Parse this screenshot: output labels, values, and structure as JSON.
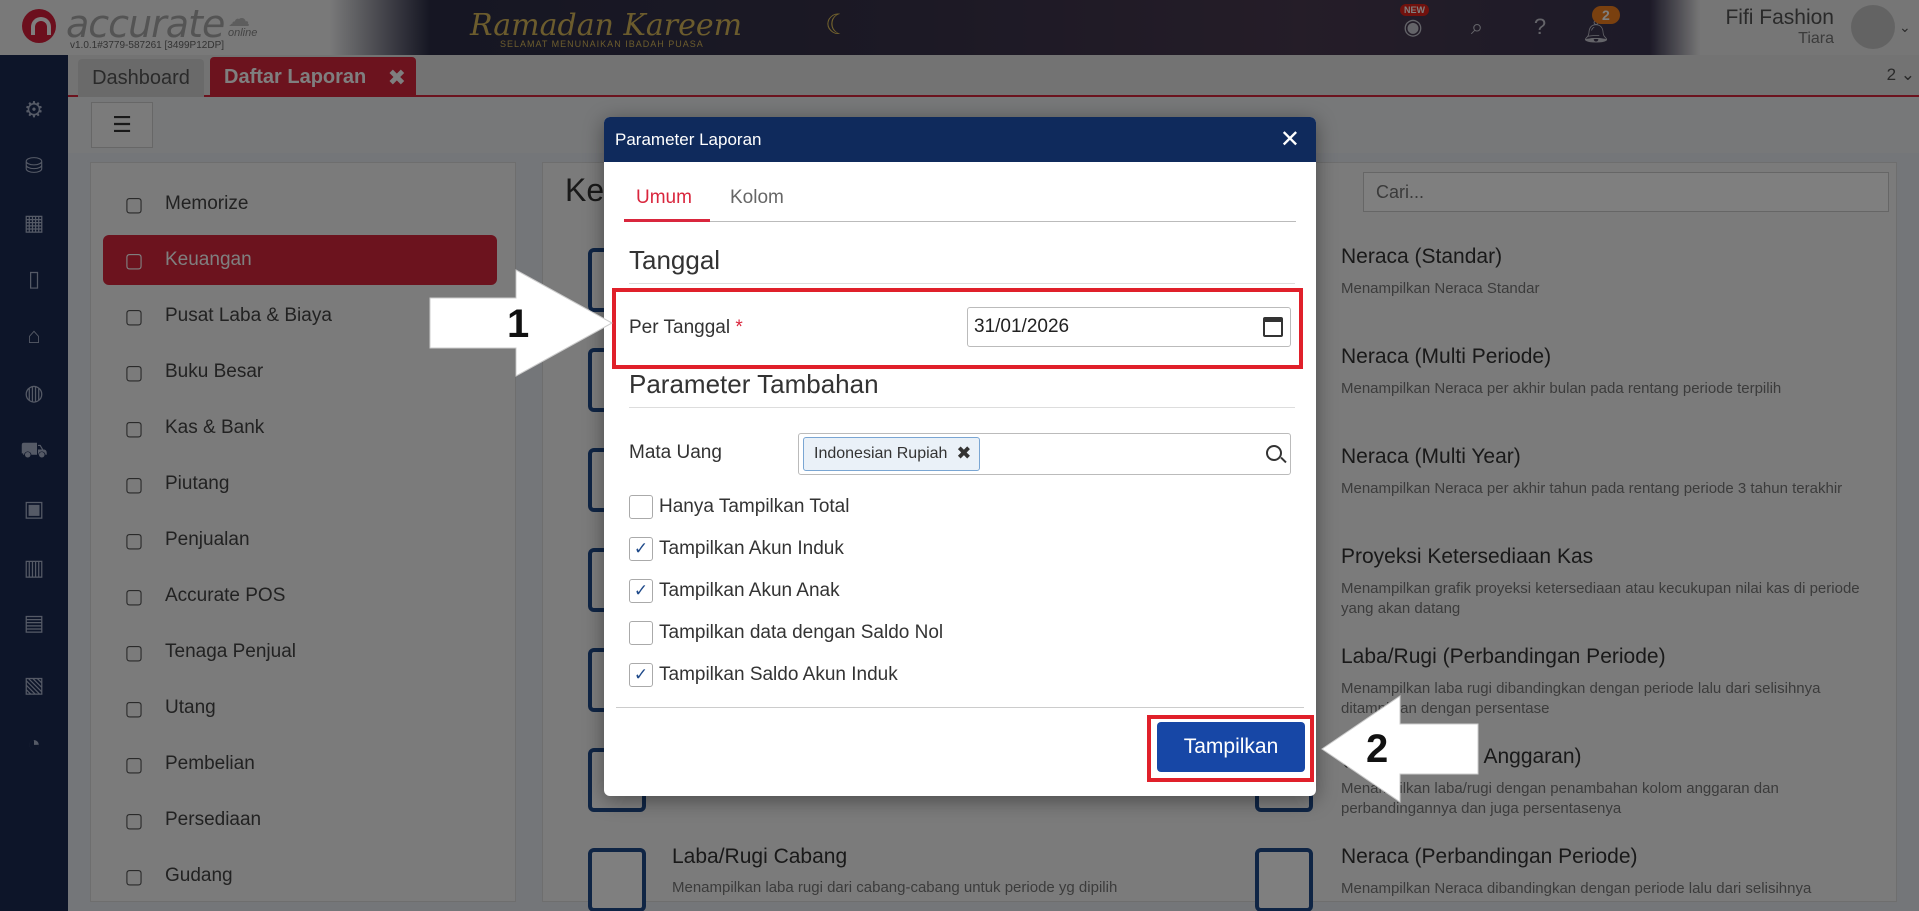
{
  "topbar": {
    "logo_text": "accurate",
    "logo_online": "online",
    "version": "v1.0.1#3779-587261 [3499P12DP]",
    "banner_title": "Ramadan Kareem",
    "banner_subtitle": "SELAMAT MENUNAIKAN IBADAH PUASA",
    "new_badge": "NEW",
    "notification_count": "2",
    "user_name": "Fifi Fashion",
    "user_sub": "Tiara"
  },
  "tabs": {
    "dashboard": "Dashboard",
    "active": "Daftar Laporan",
    "count": "2"
  },
  "menu": {
    "items": [
      {
        "label": "Memorize",
        "icon": "save-icon"
      },
      {
        "label": "Keuangan",
        "icon": "money-bag-icon"
      },
      {
        "label": "Pusat Laba & Biaya",
        "icon": "grid-icon"
      },
      {
        "label": "Buku Besar",
        "icon": "ledger-icon"
      },
      {
        "label": "Kas & Bank",
        "icon": "wallet-icon"
      },
      {
        "label": "Piutang",
        "icon": "receivable-icon"
      },
      {
        "label": "Penjualan",
        "icon": "cart-icon"
      },
      {
        "label": "Accurate POS",
        "icon": "pos-icon"
      },
      {
        "label": "Tenaga Penjual",
        "icon": "salesperson-icon"
      },
      {
        "label": "Utang",
        "icon": "payable-icon"
      },
      {
        "label": "Pembelian",
        "icon": "purchase-icon"
      },
      {
        "label": "Persediaan",
        "icon": "inventory-icon"
      },
      {
        "label": "Gudang",
        "icon": "warehouse-icon"
      }
    ]
  },
  "reports": {
    "panel_title": "Ke",
    "search_placeholder": "Cari...",
    "items": [
      {
        "title": "Neraca (Standar)",
        "desc": "Menampilkan Neraca Standar"
      },
      {
        "title": "Neraca (Multi Periode)",
        "desc": "Menampilkan Neraca per akhir bulan pada rentang periode terpilih"
      },
      {
        "title": "Neraca (Multi Year)",
        "desc": "Menampilkan Neraca per akhir tahun pada rentang periode 3 tahun terakhir"
      },
      {
        "title": "Proyeksi Ketersediaan Kas",
        "desc": "Menampilkan grafik proyeksi ketersediaan atau kecukupan nilai kas di periode yang akan datang"
      },
      {
        "title": "Laba/Rugi (Perbandingan Periode)",
        "desc": "Menampilkan laba rugi dibandingkan dengan periode lalu dari selisihnya ditampilkan dengan persentase"
      },
      {
        "title": "(Perbandingan Anggaran)",
        "desc": "Menampilkan laba/rugi dengan penambahan kolom anggaran dan perbandingannya dan juga persentasenya"
      },
      {
        "title": "Neraca (Perbandingan Periode)",
        "desc": "Menampilkan Neraca dibandingkan dengan periode lalu dari selisihnya"
      }
    ],
    "left_item": {
      "title": "Laba/Rugi Cabang",
      "desc": "Menampilkan laba rugi dari cabang-cabang untuk periode yg dipilih"
    }
  },
  "modal": {
    "title": "Parameter Laporan",
    "tab_umum": "Umum",
    "tab_kolom": "Kolom",
    "section_tanggal": "Tanggal",
    "per_tanggal_label": "Per Tanggal",
    "required_mark": "*",
    "per_tanggal_value": "31/01/2026",
    "section_tambahan": "Parameter Tambahan",
    "mata_uang_label": "Mata Uang",
    "currency_tag": "Indonesian Rupiah",
    "checkboxes": [
      {
        "label": "Hanya Tampilkan Total",
        "checked": false
      },
      {
        "label": "Tampilkan Akun Induk",
        "checked": true
      },
      {
        "label": "Tampilkan Akun Anak",
        "checked": true
      },
      {
        "label": "Tampilkan data dengan Saldo Nol",
        "checked": false
      },
      {
        "label": "Tampilkan Saldo Akun Induk",
        "checked": true
      }
    ],
    "submit_label": "Tampilkan"
  },
  "annotations": {
    "step1": "1",
    "step2": "2"
  },
  "colors": {
    "accent": "#d9263d",
    "modal_header": "#0f2a5c",
    "primary_button": "#1747a6",
    "rail": "#1b2a52"
  }
}
